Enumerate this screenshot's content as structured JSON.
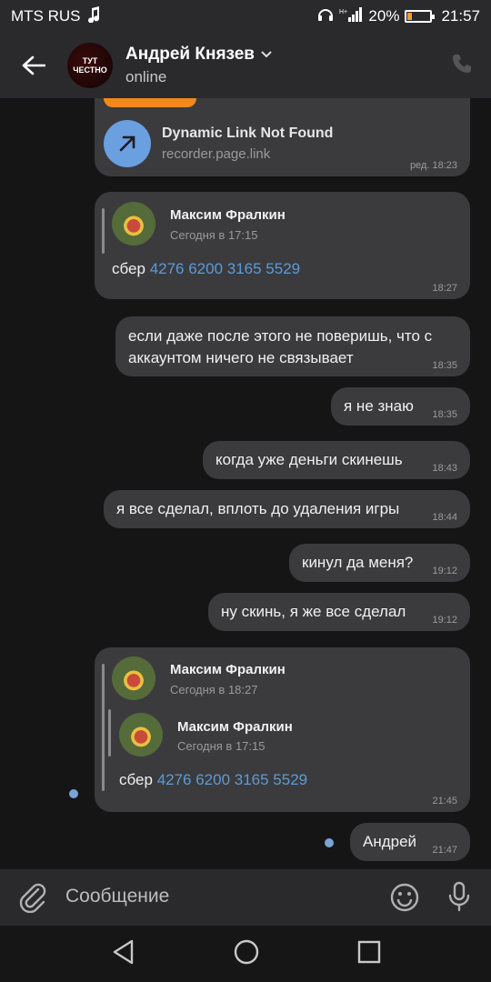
{
  "status_bar": {
    "carrier": "MTS RUS",
    "battery": "20%",
    "time": "21:57",
    "battery_level": 0.2,
    "battery_color": "#ff9a2a"
  },
  "header": {
    "contact_name": "Андрей Князев",
    "status": "online",
    "avatar_line1": "ТУТ",
    "avatar_line2": "ЧЕСТНО"
  },
  "messages": {
    "link_preview": {
      "title": "Dynamic Link Not Found",
      "domain": "recorder.page.link",
      "time": "ред. 18:23"
    },
    "fwd1": {
      "name": "Максим Фралкин",
      "date": "Сегодня в 17:15",
      "text_prefix": "сбер ",
      "card": "4276 6200 3165 5529",
      "time": "18:27"
    },
    "m1": {
      "text": "если даже после этого не поверишь, что с аккаунтом ничего не связывает",
      "time": "18:35"
    },
    "m2": {
      "text": "я не знаю",
      "time": "18:35"
    },
    "m3": {
      "text": "когда уже деньги скинешь",
      "time": "18:43"
    },
    "m4": {
      "text": "я все сделал, вплоть до удаления игры",
      "time": "18:44"
    },
    "m5": {
      "text": "кинул да меня?",
      "time": "19:12"
    },
    "m6": {
      "text": "ну скинь, я же все сделал",
      "time": "19:12"
    },
    "fwd2": {
      "name": "Максим Фралкин",
      "date": "Сегодня в 18:27",
      "inner_name": "Максим Фралкин",
      "inner_date": "Сегодня в 17:15",
      "text_prefix": "сбер ",
      "card": "4276 6200 3165 5529",
      "time": "21:45"
    },
    "m7": {
      "text": "Андрей",
      "time": "21:47"
    }
  },
  "input": {
    "placeholder": "Сообщение"
  },
  "colors": {
    "accent_link": "#5b9bd8",
    "bubble": "#3b3b3d",
    "link_icon": "#6a9fe0"
  }
}
